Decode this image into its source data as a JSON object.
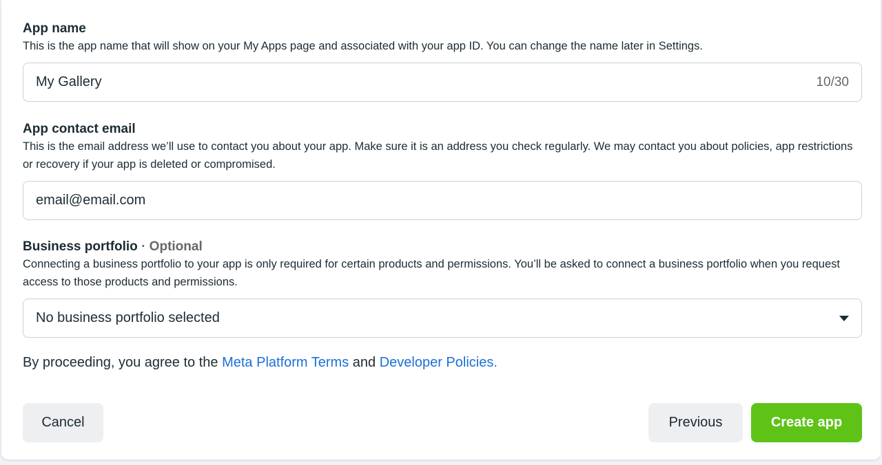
{
  "app_name": {
    "label": "App name",
    "description": "This is the app name that will show on your My Apps page and associated with your app ID. You can change the name later in Settings.",
    "value": "My Gallery",
    "counter": "10/30"
  },
  "contact_email": {
    "label": "App contact email",
    "description": "This is the email address we’ll use to contact you about your app. Make sure it is an address you check regularly. We may contact you about policies, app restrictions or recovery if your app is deleted or compromised.",
    "value": "email@email.com"
  },
  "business_portfolio": {
    "label": "Business portfolio",
    "optional": " · Optional",
    "description": "Connecting a business portfolio to your app is only required for certain products and permissions. You’ll be asked to connect a business portfolio when you request access to those products and permissions.",
    "selected": "No business portfolio selected",
    "icon": "caret-down-icon"
  },
  "agreement": {
    "prefix": "By proceeding, you agree to the ",
    "terms_link": "Meta Platform Terms",
    "middle": " and ",
    "policies_link": "Developer Policies.",
    "link_color": "#1b6fd8"
  },
  "buttons": {
    "cancel": "Cancel",
    "previous": "Previous",
    "create": "Create app",
    "create_color": "#5ec316"
  }
}
